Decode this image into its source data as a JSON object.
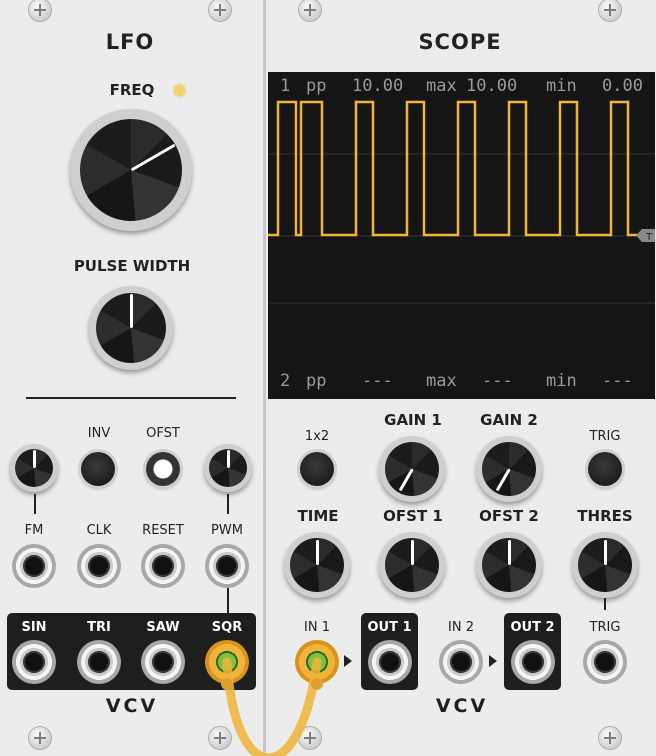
{
  "lfo": {
    "title": "LFO",
    "freq_label": "FREQ",
    "pulse_width_label": "PULSE WIDTH",
    "inv_label": "INV",
    "ofst_label": "OFST",
    "inputs": [
      "FM",
      "CLK",
      "RESET",
      "PWM"
    ],
    "outputs": [
      "SIN",
      "TRI",
      "SAW",
      "SQR"
    ],
    "brand": "VCV"
  },
  "scope": {
    "title": "SCOPE",
    "ch1": {
      "num": "1",
      "pp_label": "pp",
      "pp": "10.00",
      "max_label": "max",
      "max": "10.00",
      "min_label": "min",
      "min": "0.00"
    },
    "ch2": {
      "num": "2",
      "pp_label": "pp",
      "pp": "---",
      "max_label": "max",
      "max": "---",
      "min_label": "min",
      "min": "---"
    },
    "trigger_marker": "T",
    "labels": {
      "x1x2": "1x2",
      "gain1": "GAIN 1",
      "gain2": "GAIN 2",
      "trig": "TRIG",
      "time": "TIME",
      "ofst1": "OFST 1",
      "ofst2": "OFST 2",
      "thres": "THRES",
      "in1": "IN 1",
      "out1": "OUT 1",
      "in2": "IN 2",
      "out2": "OUT 2",
      "trig_in": "TRIG"
    },
    "brand": "VCV"
  },
  "colors": {
    "trace": "#f0b43a",
    "cable": "#f0b43a",
    "led": "#f2d06b"
  },
  "icons": {
    "screw": "screw-icon",
    "arrow": "triangle-right-icon"
  }
}
